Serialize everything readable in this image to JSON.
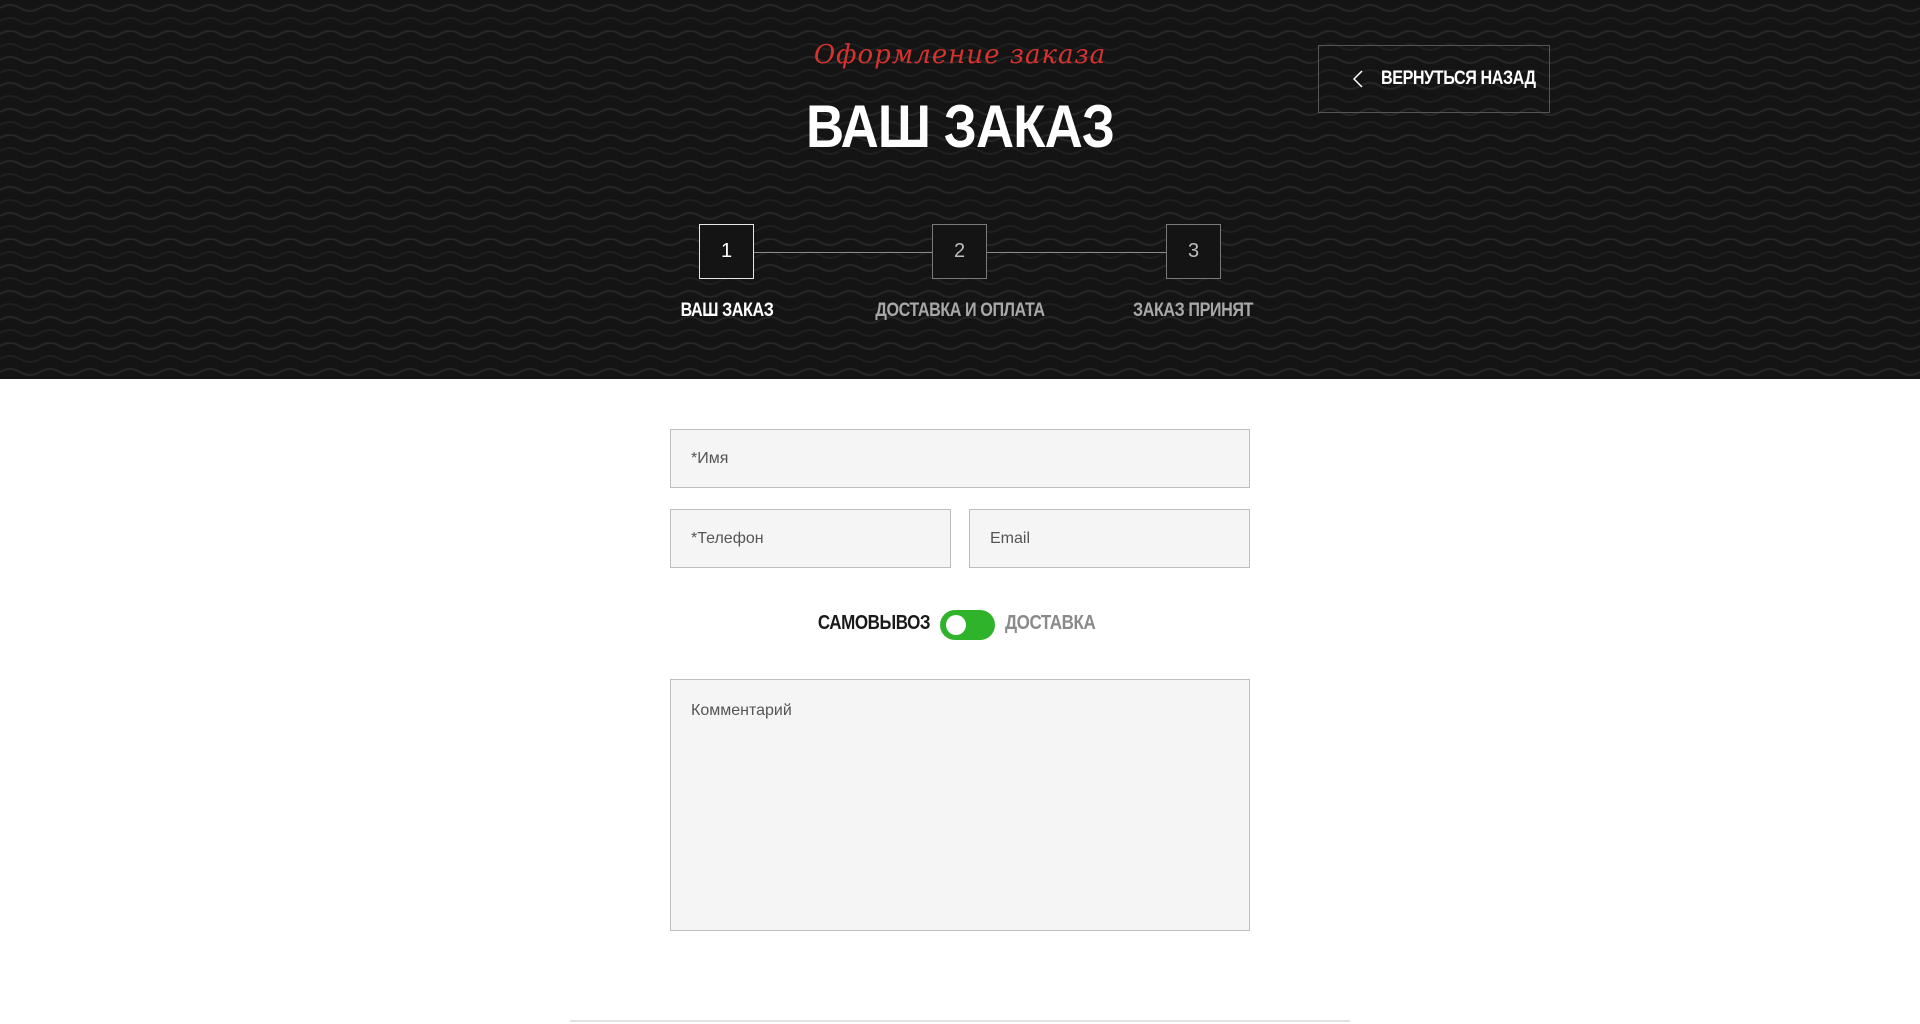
{
  "header": {
    "subtitle": "Оформление заказа",
    "title": "ВАШ ЗАКАЗ",
    "back_button_label": "ВЕРНУТЬСЯ НАЗАД",
    "back_icon": "chevron-left-icon"
  },
  "stepper": {
    "current_step": 1,
    "steps": [
      {
        "number": "1",
        "label": "ВАШ ЗАКАЗ",
        "active": true
      },
      {
        "number": "2",
        "label": "ДОСТАВКА И ОПЛАТА",
        "active": false
      },
      {
        "number": "3",
        "label": "ЗАКАЗ ПРИНЯТ",
        "active": false
      }
    ]
  },
  "form": {
    "name_placeholder": "*Имя",
    "phone_placeholder": "*Телефон",
    "email_placeholder": "Email",
    "comment_placeholder": "Комментарий",
    "delivery_toggle": {
      "left_label": "САМОВЫВОЗ",
      "right_label": "ДОСТАВКА",
      "selected": "САМОВЫВОЗ"
    }
  },
  "colors": {
    "hero_background": "#141414",
    "accent_red": "#d8322e",
    "toggle_green": "#2fb32a",
    "field_background": "#f5f5f5"
  }
}
